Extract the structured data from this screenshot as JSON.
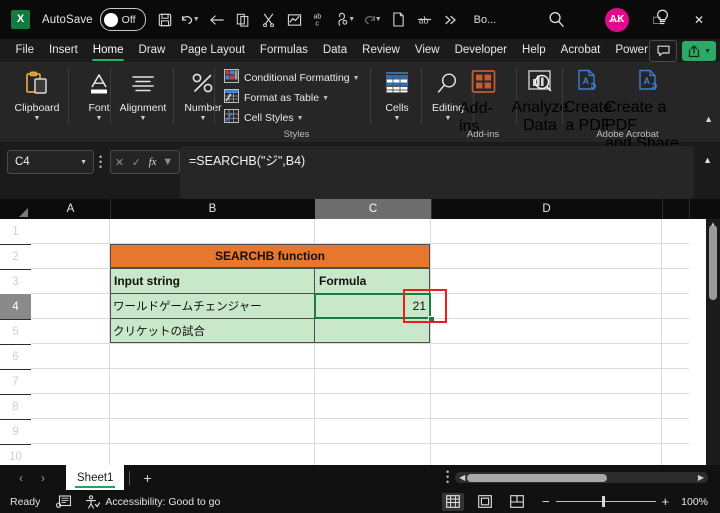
{
  "titlebar": {
    "app_icon": "excel-icon",
    "app_letter": "X",
    "autosave_label": "AutoSave",
    "autosave_state": "Off",
    "quick_access": [
      {
        "name": "save-icon",
        "glyph": "save"
      },
      {
        "name": "undo-icon",
        "glyph": "undo"
      },
      {
        "name": "back-arrow-icon",
        "glyph": "back"
      },
      {
        "name": "copy-icon",
        "glyph": "copy"
      },
      {
        "name": "cut-icon",
        "glyph": "cut"
      },
      {
        "name": "chart-icon",
        "glyph": "chart"
      },
      {
        "name": "spelling-icon",
        "glyph": "abc"
      },
      {
        "name": "format-painter-icon",
        "glyph": "painter"
      },
      {
        "name": "redo-icon",
        "glyph": "redo"
      },
      {
        "name": "new-file-icon",
        "glyph": "file"
      },
      {
        "name": "strikethrough-icon",
        "glyph": "strike"
      },
      {
        "name": "overflow-icon",
        "glyph": "more"
      }
    ],
    "document_title": "Bo...",
    "search_icon": "search-icon",
    "avatar_initials": "AK",
    "help_icon": "lightbulb-icon",
    "minimize": "—",
    "maximize": "□",
    "close": "✕"
  },
  "ribbon": {
    "tabs": [
      {
        "label": "File",
        "active": false
      },
      {
        "label": "Insert",
        "active": false
      },
      {
        "label": "Home",
        "active": true
      },
      {
        "label": "Draw",
        "active": false
      },
      {
        "label": "Page Layout",
        "active": false
      },
      {
        "label": "Formulas",
        "active": false
      },
      {
        "label": "Data",
        "active": false
      },
      {
        "label": "Review",
        "active": false
      },
      {
        "label": "View",
        "active": false
      },
      {
        "label": "Developer",
        "active": false
      },
      {
        "label": "Help",
        "active": false
      },
      {
        "label": "Acrobat",
        "active": false
      },
      {
        "label": "Power Pivot",
        "active": false
      }
    ],
    "comments_icon": "comment-icon",
    "share_label": "",
    "groups": [
      {
        "label": "Clipboard",
        "icon": "clipboard-icon"
      },
      {
        "label": "Font",
        "icon": "font-icon"
      },
      {
        "label": "Alignment",
        "icon": "alignment-icon"
      },
      {
        "label": "Number",
        "icon": "percent-icon"
      }
    ],
    "styles": {
      "group_title": "Styles",
      "items": [
        {
          "label": "Conditional Formatting",
          "icon": "conditional-formatting-icon",
          "has_chevron": true
        },
        {
          "label": "Format as Table",
          "icon": "format-as-table-icon",
          "has_chevron": true
        },
        {
          "label": "Cell Styles",
          "icon": "cell-styles-icon",
          "has_chevron": true
        }
      ]
    },
    "cells_group": {
      "label": "Cells",
      "icon": "cells-icon"
    },
    "editing_group": {
      "label": "Editing",
      "icon": "editing-magnifier-icon"
    },
    "addins": {
      "group_title": "Add-ins",
      "items": [
        {
          "label": "Add-ins",
          "icon": "addins-grid-icon"
        },
        {
          "label": "Analyze\nData",
          "line1": "Analyze",
          "line2": "Data",
          "icon": "analyze-data-icon"
        }
      ]
    },
    "acrobat": {
      "group_title": "Adobe Acrobat",
      "items": [
        {
          "line1": "Create",
          "line2": "a PDF",
          "icon": "create-pdf-icon"
        },
        {
          "line1": "Create a PDF",
          "line2": "and Share link",
          "icon": "create-pdf-share-icon"
        }
      ]
    },
    "collapse_icon": "chevron-up-icon"
  },
  "formula_bar": {
    "name_box_value": "C4",
    "name_box_chevron": "chevron-down-icon",
    "cancel_icon": "✕",
    "confirm_icon": "✓",
    "fx_label": "fx",
    "formula": "=SEARCHB(\"ジ\",B4)",
    "expand_icon": "chevron-down-icon"
  },
  "grid": {
    "columns": [
      {
        "label": "A",
        "selected": false
      },
      {
        "label": "B",
        "selected": false
      },
      {
        "label": "C",
        "selected": true
      },
      {
        "label": "D",
        "selected": false
      }
    ],
    "rows": [
      {
        "label": "1",
        "selected": false
      },
      {
        "label": "2",
        "selected": false
      },
      {
        "label": "3",
        "selected": false
      },
      {
        "label": "4",
        "selected": true
      },
      {
        "label": "5",
        "selected": false
      },
      {
        "label": "6",
        "selected": false
      },
      {
        "label": "7",
        "selected": false
      },
      {
        "label": "8",
        "selected": false
      },
      {
        "label": "9",
        "selected": false
      },
      {
        "label": "10",
        "selected": false
      }
    ],
    "cells": {
      "b2_title": "SEARCHB function",
      "b3_header": "Input string",
      "c3_header": "Formula",
      "b4_value": "ワールドゲームチェンジャー",
      "b5_value": "クリケットの試合",
      "c4_value": "21",
      "c5_value": ""
    },
    "active_cell": "C4",
    "colors": {
      "header_orange": "#e8762c",
      "cell_green": "#c9e7c9",
      "selection_green": "#1d7a43",
      "annotation_red": "#ee1c1c"
    }
  },
  "sheet_bar": {
    "prev_icon": "chevron-left-icon",
    "next_icon": "chevron-right-icon",
    "tabs": [
      {
        "label": "Sheet1",
        "active": true
      }
    ],
    "add_sheet_icon": "plus-icon"
  },
  "status_bar": {
    "status": "Ready",
    "recording_icon": "macro-record-icon",
    "accessibility_icon": "accessibility-icon",
    "accessibility_text": "Accessibility: Good to go",
    "views": [
      {
        "name": "normal-view",
        "icon": "grid-view-icon",
        "active": true
      },
      {
        "name": "page-layout-view",
        "icon": "page-layout-icon",
        "active": false
      },
      {
        "name": "page-break-view",
        "icon": "page-break-icon",
        "active": false
      }
    ],
    "zoom_out": "−",
    "zoom_in": "+",
    "zoom_level": "100%"
  }
}
